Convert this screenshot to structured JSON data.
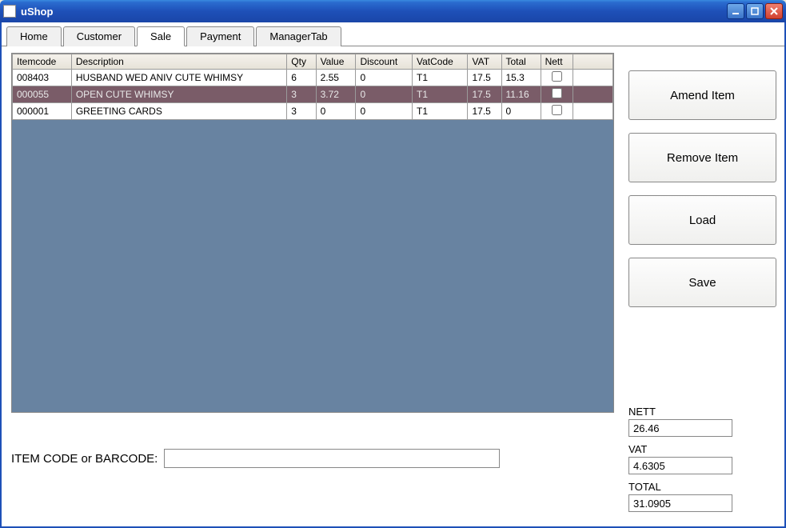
{
  "window": {
    "title": "uShop"
  },
  "tabs": [
    {
      "label": "Home"
    },
    {
      "label": "Customer"
    },
    {
      "label": "Sale",
      "active": true
    },
    {
      "label": "Payment"
    },
    {
      "label": "ManagerTab"
    }
  ],
  "grid": {
    "columns": [
      "Itemcode",
      "Description",
      "Qty",
      "Value",
      "Discount",
      "VatCode",
      "VAT",
      "Total",
      "Nett"
    ],
    "rows": [
      {
        "itemcode": "008403",
        "description": "HUSBAND WED ANIV CUTE WHIMSY",
        "qty": "6",
        "value": "2.55",
        "discount": "0",
        "vatcode": "T1",
        "vat": "17.5",
        "total": "15.3",
        "nett": false,
        "selected": false
      },
      {
        "itemcode": "000055",
        "description": "OPEN CUTE WHIMSY",
        "qty": "3",
        "value": "3.72",
        "discount": "0",
        "vatcode": "T1",
        "vat": "17.5",
        "total": "11.16",
        "nett": false,
        "selected": true
      },
      {
        "itemcode": "000001",
        "description": "GREETING CARDS",
        "qty": "3",
        "value": "0",
        "discount": "0",
        "vatcode": "T1",
        "vat": "17.5",
        "total": "0",
        "nett": false,
        "selected": false
      }
    ]
  },
  "barcode": {
    "label": "ITEM CODE or BARCODE:",
    "value": ""
  },
  "buttons": {
    "amend": "Amend Item",
    "remove": "Remove Item",
    "load": "Load",
    "save": "Save"
  },
  "totals": {
    "nett_label": "NETT",
    "nett": "26.46",
    "vat_label": "VAT",
    "vat": "4.6305",
    "total_label": "TOTAL",
    "total": "31.0905"
  }
}
